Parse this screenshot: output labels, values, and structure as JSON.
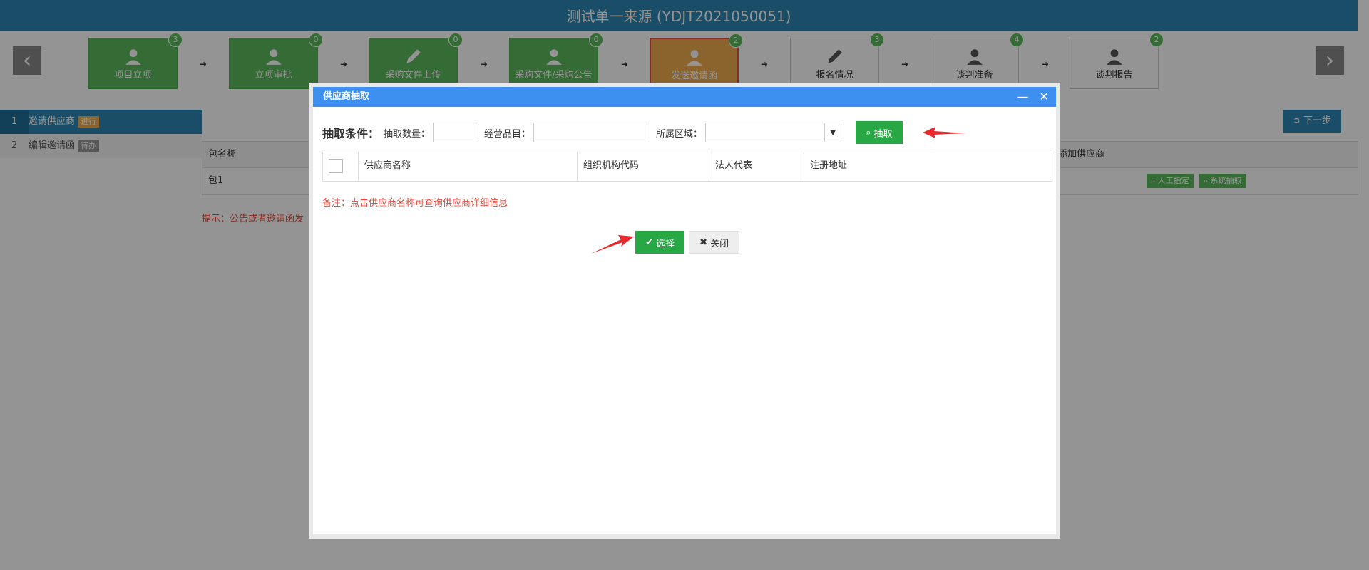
{
  "page_title": "测试单一来源 (YDJT2021050051)",
  "nav": {
    "prev_icon": "‹",
    "next_icon": "›"
  },
  "steps": [
    {
      "label": "项目立项",
      "badge": "3",
      "state": "done",
      "icon": "user-icon"
    },
    {
      "label": "立项审批",
      "badge": "0",
      "state": "done",
      "icon": "user-icon"
    },
    {
      "label": "采购文件上传",
      "badge": "0",
      "state": "done",
      "icon": "pencil-icon"
    },
    {
      "label": "采购文件/采购公告",
      "badge": "0",
      "state": "done",
      "icon": "user-icon"
    },
    {
      "label": "发送邀请函",
      "badge": "2",
      "state": "current",
      "icon": "user-icon"
    },
    {
      "label": "报名情况",
      "badge": "3",
      "state": "todo",
      "icon": "pencil-icon"
    },
    {
      "label": "谈判准备",
      "badge": "4",
      "state": "todo",
      "icon": "user-icon"
    },
    {
      "label": "谈判报告",
      "badge": "2",
      "state": "todo",
      "icon": "user-icon"
    }
  ],
  "left_nav": [
    {
      "num": "1",
      "label": "邀请供应商",
      "tag": "进行"
    },
    {
      "num": "2",
      "label": "编辑邀请函",
      "tag": "待办"
    }
  ],
  "next_step": "下一步",
  "main_table": {
    "header": "包名称",
    "header_right": "添加供应商",
    "row": "包1",
    "btn_manual": "人工指定",
    "btn_system": "系统抽取"
  },
  "hint": "提示：公告或者邀请函发",
  "modal": {
    "title": "供应商抽取",
    "minimize": "—",
    "close": "✕",
    "conditions_title": "抽取条件：",
    "qty_label": "抽取数量：",
    "qty_value": "",
    "category_label": "经营品目：",
    "category_value": "",
    "region_label": "所属区域：",
    "region_value": "",
    "extract_button": "抽取",
    "columns": [
      "供应商名称",
      "组织机构代码",
      "法人代表",
      "注册地址"
    ],
    "note": "备注：点击供应商名称可查询供应商详细信息",
    "select_button": "选择",
    "close_button": "关闭"
  }
}
